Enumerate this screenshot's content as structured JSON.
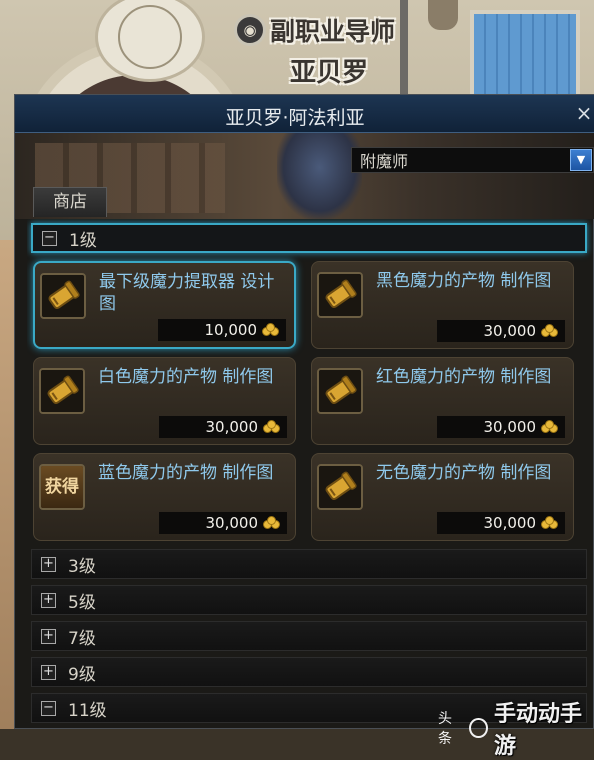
{
  "npc": {
    "job_title": "副职业导师",
    "name": "亚贝罗"
  },
  "window": {
    "title": "亚贝罗·阿法利亚",
    "close_glyph": "×",
    "npc_dropdown": {
      "selected": "附魔师",
      "arrow_glyph": "▼"
    },
    "tab": "商店"
  },
  "categories": [
    {
      "toggle": "−",
      "label": "1级",
      "expanded": true,
      "items": [
        {
          "name": "最下级魔力提取器 设计图",
          "price": "10,000",
          "icon": "scroll-icon",
          "selected": true
        },
        {
          "name": "黑色魔力的产物 制作图",
          "price": "30,000",
          "icon": "scroll-icon"
        },
        {
          "name": "白色魔力的产物 制作图",
          "price": "30,000",
          "icon": "scroll-icon"
        },
        {
          "name": "红色魔力的产物 制作图",
          "price": "30,000",
          "icon": "scroll-icon"
        },
        {
          "name": "蓝色魔力的产物 制作图",
          "price": "30,000",
          "icon": "obtain-icon",
          "icon_text": "获得"
        },
        {
          "name": "无色魔力的产物 制作图",
          "price": "30,000",
          "icon": "scroll-icon"
        }
      ]
    },
    {
      "toggle": "+",
      "label": "3级",
      "expanded": false
    },
    {
      "toggle": "+",
      "label": "5级",
      "expanded": false
    },
    {
      "toggle": "+",
      "label": "7级",
      "expanded": false
    },
    {
      "toggle": "+",
      "label": "9级",
      "expanded": false
    },
    {
      "toggle": "−",
      "label": "11级",
      "expanded": true
    }
  ],
  "watermark": {
    "source": "头条",
    "site": "手动动手游"
  },
  "colors": {
    "highlight": "#3aa9c6",
    "item_name": "#8fc9ec",
    "gold": "#e8b93a",
    "titlebar": "#1d3552"
  }
}
